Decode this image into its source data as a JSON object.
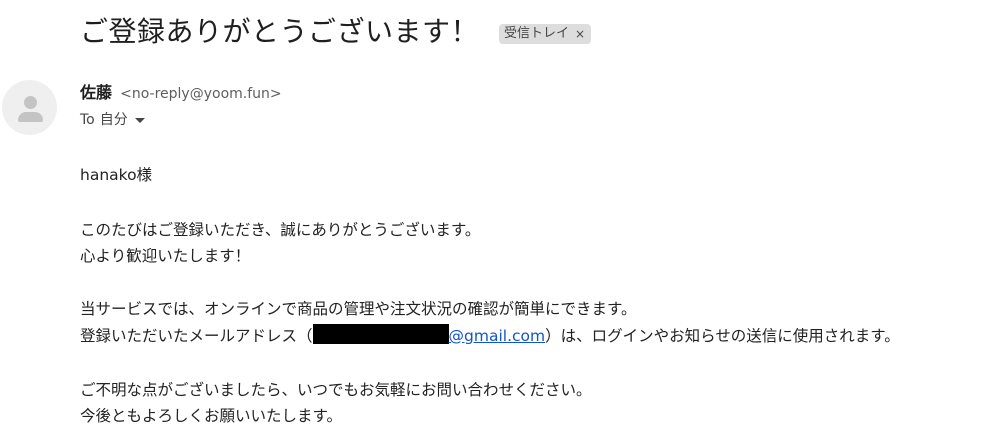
{
  "email": {
    "subject": "ご登録ありがとうございます！",
    "label": "受信トレイ",
    "label_close_glyph": "×",
    "sender": {
      "name": "佐藤",
      "address": "<no-reply@yoom.fun>"
    },
    "to": {
      "prefix": "To",
      "recipient": "自分"
    },
    "body": {
      "greeting": "hanako様",
      "p1_line1": "このたびはご登録いただき、誠にありがとうございます。",
      "p1_line2": "心より歓迎いたします！",
      "p2_line1": "当サービスでは、オンラインで商品の管理や注文状況の確認が簡単にできます。",
      "p2_line2_before": "登録いただいたメールアドレス（",
      "p2_line2_link": "@gmail.com",
      "p2_line2_after": "）は、ログインやお知らせの送信に使用されます。",
      "p3_line1": "ご不明な点がございましたら、いつでもお気軽にお問い合わせください。",
      "p3_line2": "今後ともよろしくお願いいたします。"
    }
  },
  "colors": {
    "text": "#1f1f1f",
    "chip_bg": "#dddddd",
    "link": "#1155cc",
    "redaction": "#000000"
  },
  "icons": {
    "avatar": "default-person-avatar",
    "caret": "caret-down-icon"
  }
}
